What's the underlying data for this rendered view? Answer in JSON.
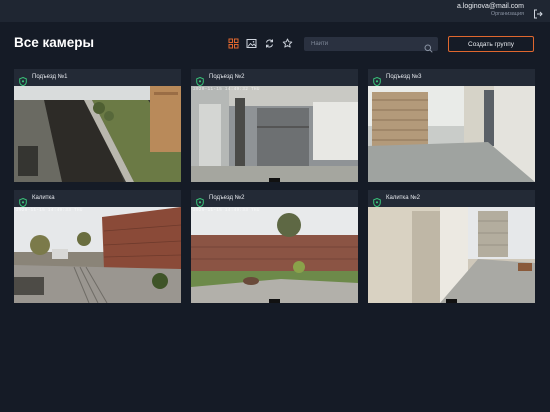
{
  "user": {
    "email": "a.loginova@mail.com",
    "organization": "Организация"
  },
  "page": {
    "title": "Все камеры"
  },
  "toolbar": {
    "icons": [
      "grid-view-icon",
      "image-gallery-icon",
      "refresh-icon",
      "star-icon"
    ],
    "active_color": "#e0672e"
  },
  "search": {
    "placeholder": "Найти",
    "value": ""
  },
  "create_group": {
    "label": "Создать группу"
  },
  "cameras": [
    {
      "name": "Подъезд №1",
      "stamp": ""
    },
    {
      "name": "Подъезд №2",
      "stamp": "2020-11-15 14:49:32 THU"
    },
    {
      "name": "Подъезд №3",
      "stamp": ""
    },
    {
      "name": "Калитка",
      "stamp": "2020-11-15 14:49:33 THU"
    },
    {
      "name": "Подъезд №2",
      "stamp": "2020-11-15 14:49:33 THU"
    },
    {
      "name": "Калитка №2",
      "stamp": ""
    }
  ],
  "colors": {
    "background": "#151b26",
    "card": "#232a36",
    "accent": "#e0672e",
    "status_green": "#39c47a"
  }
}
